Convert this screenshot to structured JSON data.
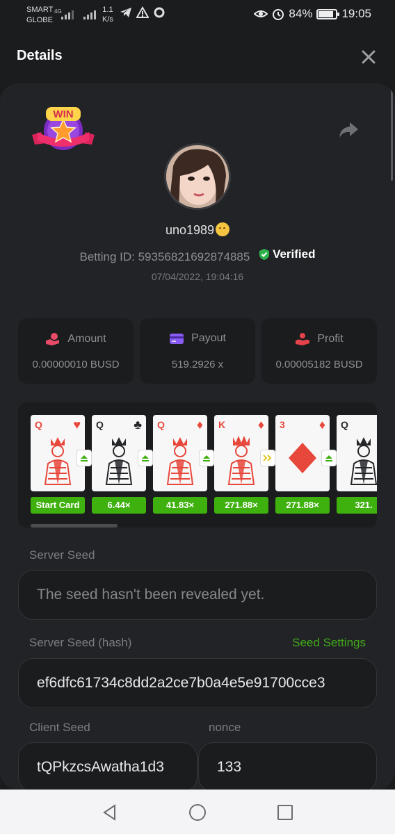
{
  "status_bar": {
    "carrier_line1": "SMART",
    "carrier_line2": "GLOBE",
    "network": "4G",
    "speed_value": "1.1",
    "speed_unit": "K/s",
    "battery": "84%",
    "battery_level": 0.84,
    "time": "19:05"
  },
  "header": {
    "title": "Details"
  },
  "profile": {
    "username": "uno1989",
    "betting_id_label": "Betting ID: 5935682169287488​5",
    "verified_label": "Verified",
    "timestamp": "07/04/2022, 19:04:16",
    "badge_text": "WIN"
  },
  "stats": {
    "amount": {
      "label": "Amount",
      "value": "0.00000010 BUSD"
    },
    "payout": {
      "label": "Payout",
      "value": "519.2926 x"
    },
    "profit": {
      "label": "Profit",
      "value": "0.00005182 BUSD"
    }
  },
  "cards": [
    {
      "rank": "Q",
      "suit": "♥",
      "color": "#e8473b",
      "multiplier": "Start Card",
      "art": "queen"
    },
    {
      "rank": "Q",
      "suit": "♣",
      "color": "#26272b",
      "multiplier": "6.44×",
      "art": "queen",
      "arrow": "higher"
    },
    {
      "rank": "Q",
      "suit": "♦",
      "color": "#e8473b",
      "multiplier": "41.83×",
      "art": "queen",
      "arrow": "higher"
    },
    {
      "rank": "K",
      "suit": "♦",
      "color": "#e8473b",
      "multiplier": "271.88×",
      "art": "king",
      "arrow": "higher"
    },
    {
      "rank": "3",
      "suit": "♦",
      "color": "#e8473b",
      "multiplier": "271.88×",
      "art": "pip",
      "arrow": "skip"
    },
    {
      "rank": "Q",
      "suit": "",
      "color": "#26272b",
      "multiplier": "321.",
      "art": "queen",
      "arrow": "higher"
    }
  ],
  "seeds": {
    "server_seed_label": "Server Seed",
    "server_seed_value": "The seed hasn't been revealed yet.",
    "server_hash_label": "Server Seed (hash)",
    "seed_settings_link": "Seed Settings",
    "server_hash_value": "ef6dfc61734c8dd2a2ce7b0a4e5e91700cce3",
    "client_seed_label": "Client Seed",
    "client_seed_value": "tQPkzcsAwatha1d3",
    "nonce_label": "nonce",
    "nonce_value": "133"
  },
  "colors": {
    "accent_green": "#3fb10f",
    "link_green": "#41a91a",
    "verified_green": "#2fb24c",
    "card_red": "#e8473b",
    "amount_icon": "#e84b68",
    "payout_icon": "#8a5cf6",
    "profit_icon": "#e5424a"
  },
  "icons": {
    "close": "close-icon",
    "share": "share-icon",
    "verified": "shield-check-icon",
    "amount": "coins-hand-icon",
    "payout": "wallet-icon",
    "profit": "hand-coin-icon"
  }
}
